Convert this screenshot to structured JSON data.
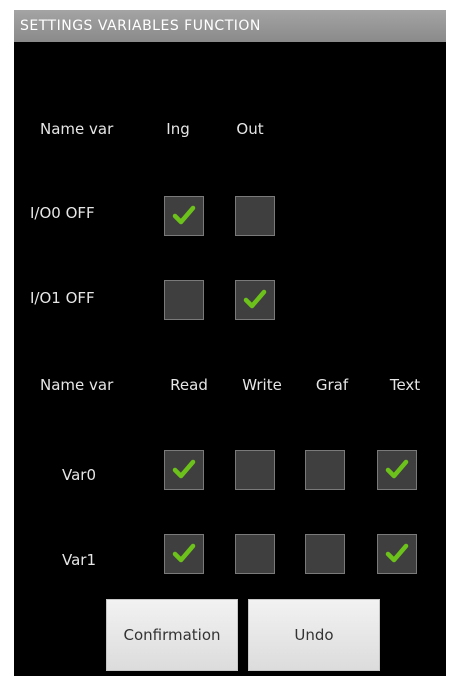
{
  "app": {
    "title": "SETTINGS VARIABLES FUNCTION"
  },
  "io_section": {
    "headers": {
      "name": "Name var",
      "ing": "Ing",
      "out": "Out"
    },
    "rows": [
      {
        "label": "I/O0 OFF",
        "ing": true,
        "out": false
      },
      {
        "label": "I/O1 OFF",
        "ing": false,
        "out": true
      }
    ]
  },
  "var_section": {
    "headers": {
      "name": "Name var",
      "read": "Read",
      "write": "Write",
      "graf": "Graf",
      "text": "Text"
    },
    "rows": [
      {
        "label": "Var0",
        "read": true,
        "write": false,
        "graf": false,
        "text": true
      },
      {
        "label": "Var1",
        "read": true,
        "write": false,
        "graf": false,
        "text": true
      }
    ]
  },
  "buttons": {
    "confirm": "Confirmation",
    "undo": "Undo"
  },
  "colors": {
    "check": "#6cc21a",
    "checkbox_bg": "#3f3f3f",
    "titlebar": "#9a9a9a"
  }
}
